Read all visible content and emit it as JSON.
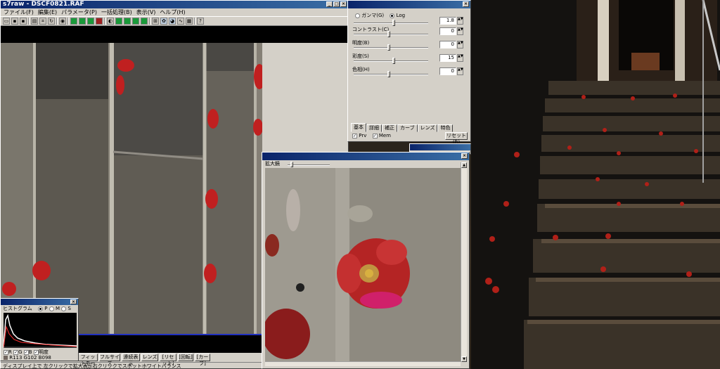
{
  "main_window": {
    "title": "s7raw - DSCF0821.RAF",
    "menus": [
      "ファイル(F)",
      "編集(E)",
      "パラメータ(P)",
      "一括処理(B)",
      "表示(V)",
      "ヘルプ(H)"
    ],
    "status_text": "ディスプレイ上で 左クリックで拡大表示右クリックでスポットホワイトバランス"
  },
  "params_panel": {
    "gamma_label": "ガンマ(G)",
    "log_label": "Log",
    "gamma_value": "1.8",
    "sliders": [
      {
        "label": "コントラスト(C)",
        "value": "0",
        "level": 0.5
      },
      {
        "label": "明度(B)",
        "value": "0",
        "level": 0.5
      },
      {
        "label": "彩度(S)",
        "value": "15",
        "level": 0.57
      },
      {
        "label": "色相(H)",
        "value": "0",
        "level": 0.5
      }
    ],
    "gamma_level": 0.55,
    "tabs": [
      "基本",
      "詳細",
      "補正",
      "カーブ",
      "レンズ",
      "特色"
    ],
    "prv_label": "Prv",
    "mem_label": "Mem",
    "reset_label": "リセット(R)"
  },
  "zoom_window": {
    "title": "拡大鏡"
  },
  "histogram": {
    "title": "ヒストグラム",
    "modes": [
      "P",
      "M",
      "S"
    ],
    "channels": [
      "R",
      "G",
      "B",
      "明度"
    ],
    "readout": "R113 G102 B098"
  },
  "bottom_buttons": [
    "フィットモード",
    "フルサイズ",
    "連続表示",
    "レンズ",
    "[リセット]",
    "[回転]",
    "[カーブ]"
  ],
  "colors": {
    "titlebar": "#0a246a",
    "window_face": "#d4d0c8",
    "flower_red": "#c02020"
  }
}
